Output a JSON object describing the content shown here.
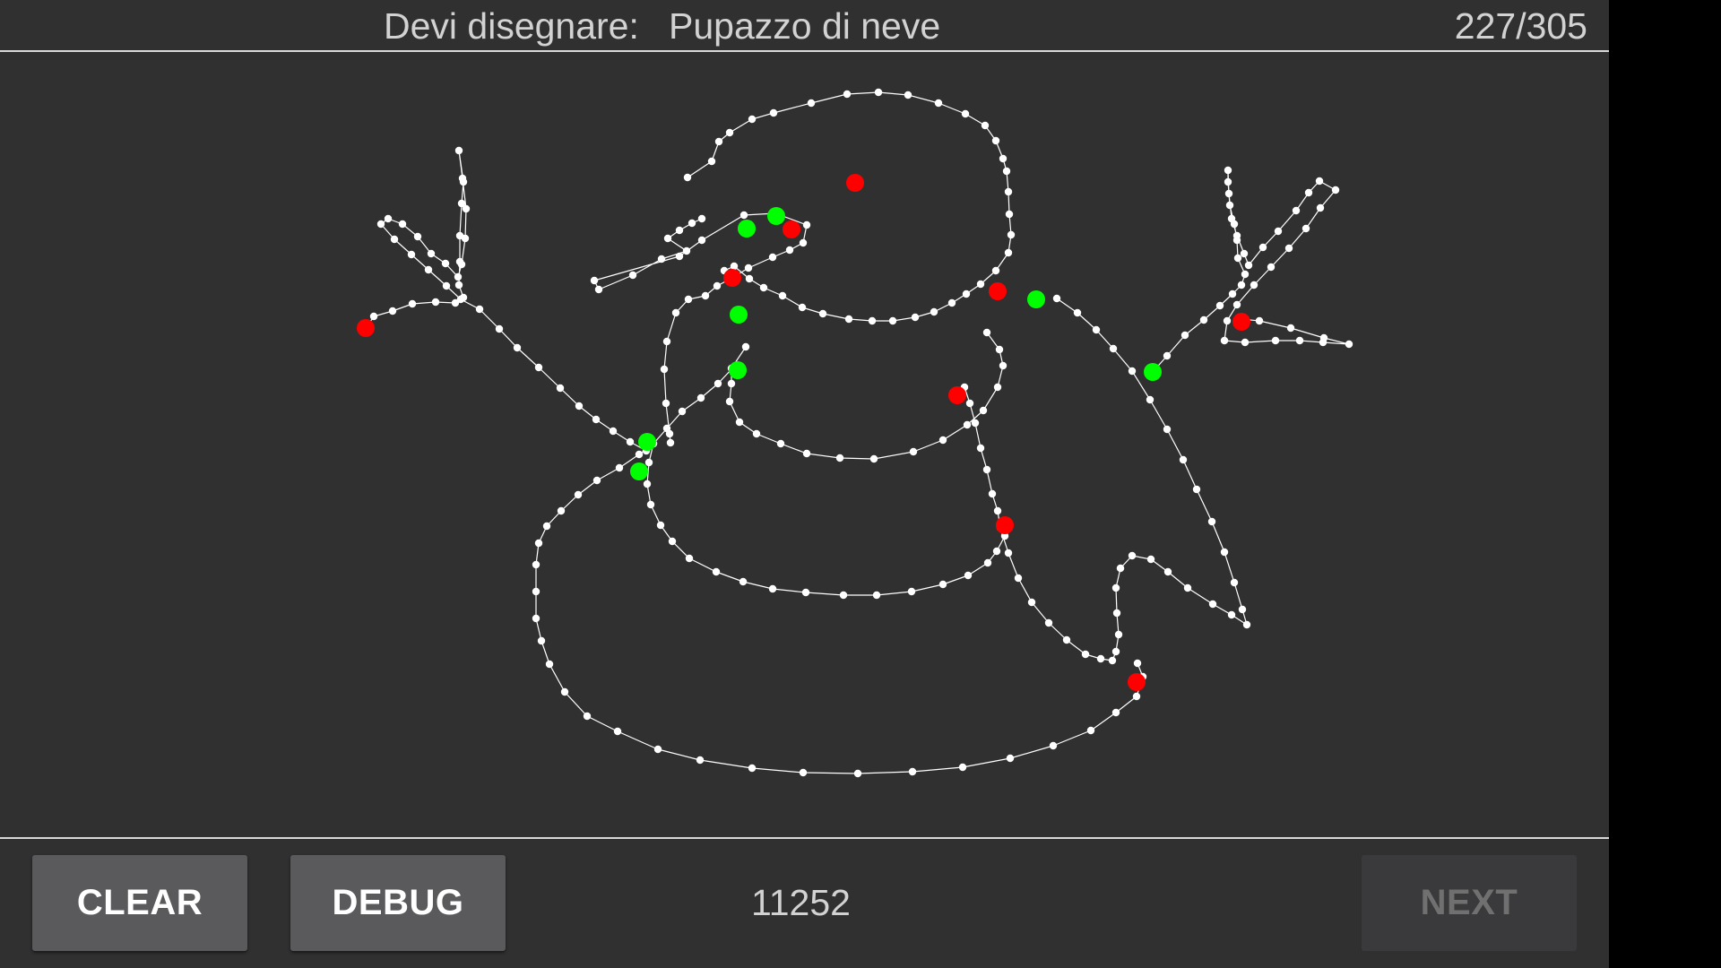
{
  "header": {
    "prompt_label": "Devi disegnare:",
    "prompt_word": "Pupazzo di neve",
    "counter": "227/305"
  },
  "footer": {
    "clear_label": "CLEAR",
    "debug_label": "DEBUG",
    "score": "11252",
    "next_label": "NEXT",
    "next_enabled": false
  },
  "colors": {
    "background": "#303030",
    "stroke": "#ffffff",
    "stroke_end": "#ff0000",
    "stroke_start": "#00ff00",
    "button": "#5a5a5c",
    "button_disabled": "#3a3a3c",
    "text": "#d2d2d2"
  }
}
